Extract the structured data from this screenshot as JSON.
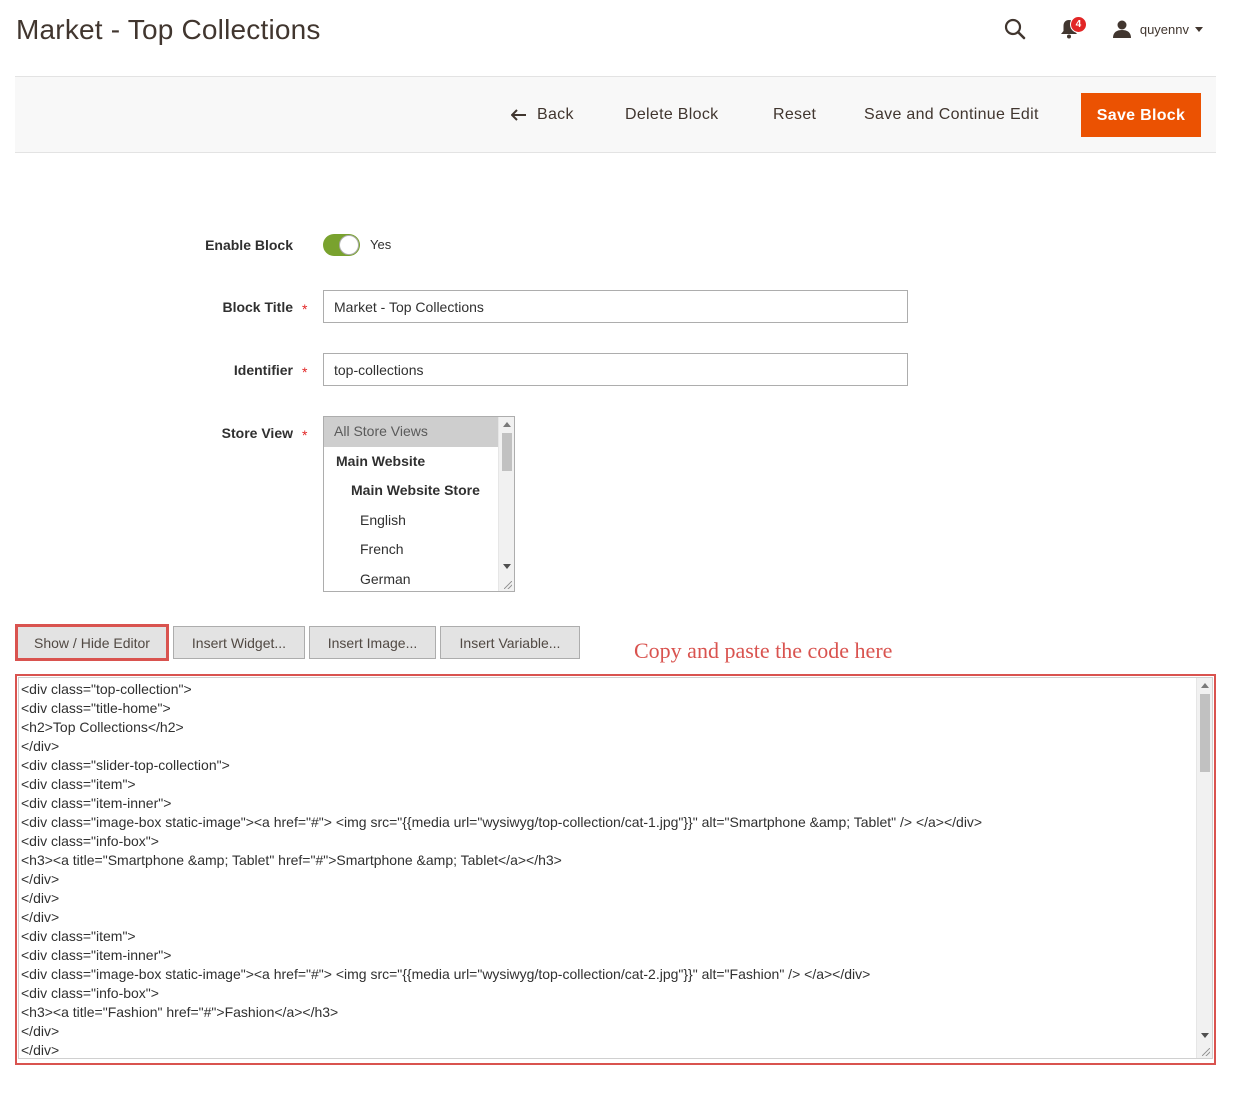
{
  "page": {
    "title": "Market - Top Collections"
  },
  "header": {
    "notifications_count": "4",
    "user_name": "quyennv"
  },
  "actions": {
    "back": "Back",
    "delete": "Delete Block",
    "reset": "Reset",
    "save_continue": "Save and Continue Edit",
    "save": "Save Block"
  },
  "form": {
    "enable_label": "Enable Block",
    "enable_value": "Yes",
    "title_label": "Block Title",
    "title_value": "Market - Top Collections",
    "identifier_label": "Identifier",
    "identifier_value": "top-collections",
    "store_view_label": "Store View",
    "store_options": [
      {
        "label": "All Store Views",
        "selected": true,
        "group": false,
        "indent": 0
      },
      {
        "label": "Main Website",
        "selected": false,
        "group": true,
        "indent": 1
      },
      {
        "label": "Main Website Store",
        "selected": false,
        "group": true,
        "indent": 2
      },
      {
        "label": "English",
        "selected": false,
        "group": false,
        "indent": 3
      },
      {
        "label": "French",
        "selected": false,
        "group": false,
        "indent": 3
      },
      {
        "label": "German",
        "selected": false,
        "group": false,
        "indent": 3
      }
    ]
  },
  "editor": {
    "show_hide": "Show / Hide Editor",
    "insert_widget": "Insert Widget...",
    "insert_image": "Insert Image...",
    "insert_variable": "Insert Variable...",
    "annotation": "Copy and paste the code here",
    "code_lines": [
      "<div class=\"top-collection\">",
      "<div class=\"title-home\">",
      "<h2>Top Collections</h2>",
      "</div>",
      "<div class=\"slider-top-collection\">",
      "<div class=\"item\">",
      "<div class=\"item-inner\">",
      "<div class=\"image-box static-image\"><a href=\"#\"> <img src=\"{{media url=\"wysiwyg/top-collection/cat-1.jpg\"}}\" alt=\"Smartphone &amp; Tablet\" /> </a></div>",
      "<div class=\"info-box\">",
      "<h3><a title=\"Smartphone &amp; Tablet\" href=\"#\">Smartphone &amp; Tablet</a></h3>",
      "</div>",
      "</div>",
      "</div>",
      "<div class=\"item\">",
      "<div class=\"item-inner\">",
      "<div class=\"image-box static-image\"><a href=\"#\"> <img src=\"{{media url=\"wysiwyg/top-collection/cat-2.jpg\"}}\" alt=\"Fashion\" /> </a></div>",
      "<div class=\"info-box\">",
      "<h3><a title=\"Fashion\" href=\"#\">Fashion</a></h3>",
      "</div>",
      "</div>"
    ]
  }
}
